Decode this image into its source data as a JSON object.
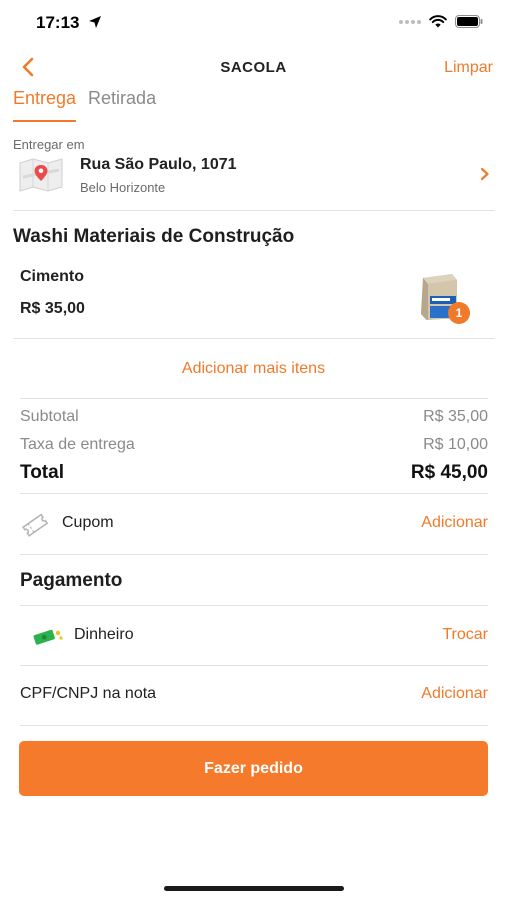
{
  "status_bar": {
    "time": "17:13"
  },
  "header": {
    "title": "SACOLA",
    "clear_label": "Limpar"
  },
  "tabs": [
    {
      "label": "Entrega",
      "active": true
    },
    {
      "label": "Retirada",
      "active": false
    }
  ],
  "delivery": {
    "label": "Entregar em",
    "street": "Rua São Paulo, 1071",
    "city": "Belo Horizonte"
  },
  "store": {
    "name": "Washi Materiais de Construção"
  },
  "cart_items": [
    {
      "name": "Cimento",
      "price": "R$ 35,00",
      "quantity": "1"
    }
  ],
  "add_more_label": "Adicionar mais itens",
  "summary": {
    "subtotal_label": "Subtotal",
    "subtotal_value": "R$ 35,00",
    "delivery_fee_label": "Taxa de entrega",
    "delivery_fee_value": "R$ 10,00",
    "total_label": "Total",
    "total_value": "R$ 45,00"
  },
  "coupon": {
    "label": "Cupom",
    "action": "Adicionar"
  },
  "payment": {
    "title": "Pagamento",
    "method": "Dinheiro",
    "action": "Trocar"
  },
  "tax_id": {
    "label": "CPF/CNPJ na nota",
    "action": "Adicionar"
  },
  "order_button": {
    "label": "Fazer pedido"
  },
  "colors": {
    "accent": "#f07a2a",
    "button": "#f57a2b",
    "divider": "#e3e3e3"
  }
}
